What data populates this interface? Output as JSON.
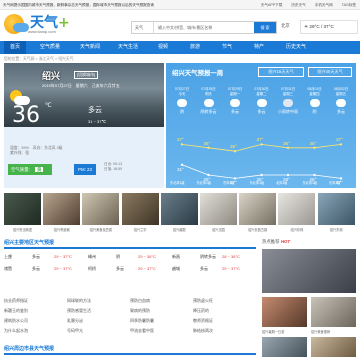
{
  "topbar": {
    "left": "天气网提示国国内城市天气预报，新鲜事杂志天气预报，国际城市天气预报以后的天气预报查询",
    "right": [
      "天气APP下载",
      "历史天气",
      "手机天气网",
      "TAG标签"
    ]
  },
  "logo": {
    "name": "天气",
    "plus": "+",
    "url": "www.tianqi.com"
  },
  "search": {
    "select": "天气",
    "placeholder": "输入中文/拼音、城市/景区名称",
    "button": "搜 索"
  },
  "header": {
    "city": "北京",
    "weather": "29°C / 37°C"
  },
  "nav": [
    "首页",
    "空气质量",
    "天气新闻",
    "天气生活",
    "视频",
    "旅游",
    "节气",
    "特产",
    "历史天气"
  ],
  "breadcrumb": "您的位置：天气网 > 浙江天气 > 绍兴天气",
  "current": {
    "city": "绍兴",
    "switch": "[切换城市]",
    "date": "2019年07月27日　星期六　己亥年六月廿五",
    "temp": "36",
    "unit": "℃",
    "condition": "多云",
    "range": "31 ~ 37℃",
    "humidity": "湿度：59%　风向：东北风 3级",
    "ultraviolet": "紫外线：强",
    "aqi_label": "空气质量：",
    "aqi_value": "良",
    "pm": "PM: 23",
    "sunrise": "日出: 05:13",
    "sunset": "日落: 18:59"
  },
  "forecast": {
    "title": "绍兴天气预报一周",
    "btn15": "绍兴15天天气",
    "btn40": "绍兴40天天气",
    "days": [
      {
        "date": "07月27日",
        "week": "今天",
        "cond": "阴"
      },
      {
        "date": "07月28日",
        "week": "明天",
        "cond": "阴转多云"
      },
      {
        "date": "07月29日",
        "week": "星期一",
        "cond": "多云"
      },
      {
        "date": "07月30日",
        "week": "星期二",
        "cond": "多云"
      },
      {
        "date": "07月31日",
        "week": "星期三",
        "cond": "小雨转中雨"
      },
      {
        "date": "08月01日",
        "week": "星期四",
        "cond": "阴"
      },
      {
        "date": "08月02日",
        "week": "星期五",
        "cond": "多云"
      }
    ],
    "highs": [
      "37°",
      "36°",
      "35°",
      "37°",
      "36°",
      "36°",
      "37°"
    ],
    "lows": [
      "31°",
      "28°",
      "27°",
      "28°",
      "28°",
      "28°",
      "27°"
    ],
    "winds": [
      "东北风3级",
      "东北风3级",
      "东风3级",
      "东北风3级",
      "北风3级",
      "东北风3级",
      "东风3级"
    ]
  },
  "photos": [
    "绍兴鲁迅故居",
    "绍兴黄酒城",
    "绍兴美食臭豆腐",
    "绍兴兰亭",
    "绍兴越剧",
    "绍兴沈园",
    "绍兴安昌古镇",
    "绍兴珍珠",
    "绍兴东湖"
  ],
  "cities_title": "绍兴主要地区天气预报",
  "cities": [
    [
      {
        "n": "上虞",
        "c": "多云",
        "t": "29 ~ 37°C"
      },
      {
        "n": "嵊州",
        "c": "阴",
        "t": "29 ~ 36°C"
      },
      {
        "n": "新昌",
        "c": "阴转多云",
        "t": "28 ~ 36°C"
      }
    ],
    [
      {
        "n": "诸暨",
        "c": "多云",
        "t": "29 ~ 37°C"
      },
      {
        "n": "柯桥",
        "c": "多云",
        "t": "29 ~ 37°C"
      },
      {
        "n": "越城",
        "c": "多云",
        "t": "29 ~ 37°C"
      }
    ]
  ],
  "links": [
    [
      "执业药师指证",
      "网球联的方法",
      "预防白血病",
      "预防虚火旺"
    ],
    [
      "新疆玉的鉴别",
      "预防感冒生活",
      "胃病的预防",
      "降压药的"
    ],
    [
      "建筑防水公司",
      "乳腺分泌",
      "四季防暑防暑",
      "教师资格证"
    ],
    [
      "为什么起水泡",
      "号码甲亢",
      "甲流去看中医",
      "肺结核两次"
    ]
  ],
  "side": {
    "title": "热点推荐",
    "tag": "HOT",
    "cap1": "绍兴暑期一日游",
    "cap2": "绍兴美食推荐"
  },
  "bottom_title": "绍兴周边市县天气预报"
}
